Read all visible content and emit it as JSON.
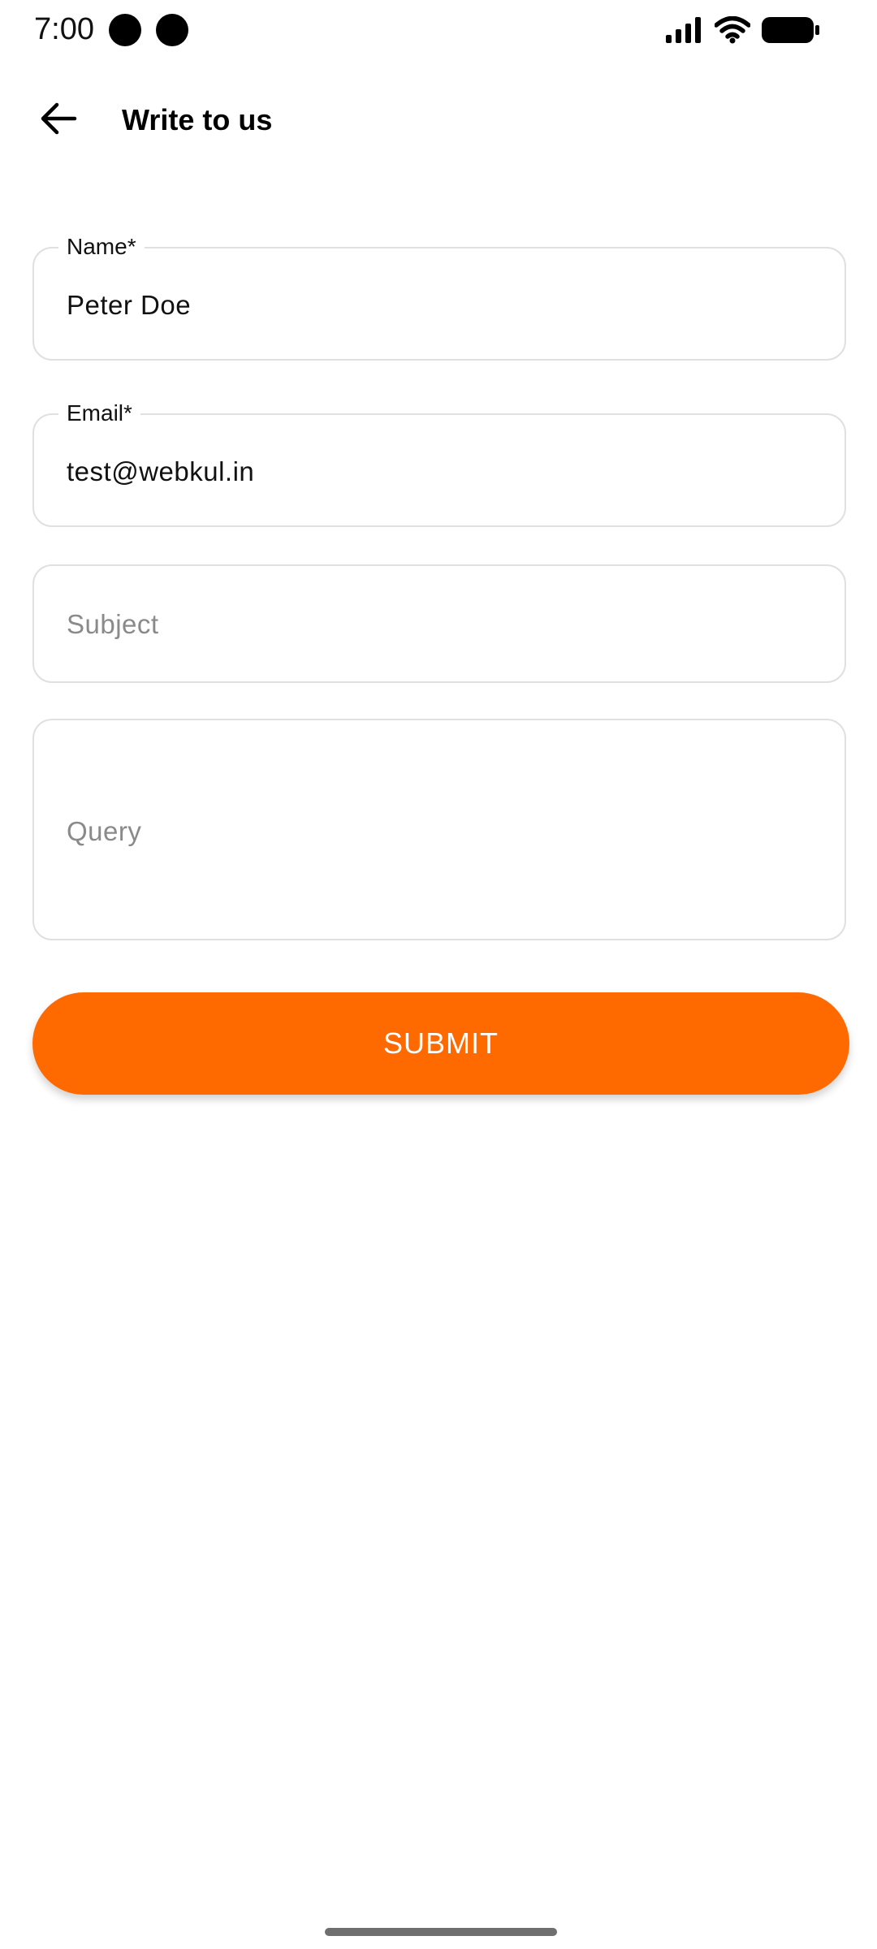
{
  "status_bar": {
    "time": "7:00",
    "icons": [
      "notification-dot-icon",
      "notification-dot-icon",
      "signal-icon",
      "wifi-icon",
      "battery-icon"
    ]
  },
  "app_bar": {
    "back_icon": "arrow-left-icon",
    "title": "Write to us"
  },
  "form": {
    "name": {
      "label": "Name*",
      "value": "Peter Doe"
    },
    "email": {
      "label": "Email*",
      "value": "test@webkul.in"
    },
    "subject": {
      "placeholder": "Subject",
      "value": ""
    },
    "query": {
      "placeholder": "Query",
      "value": ""
    },
    "submit_label": "SUBMIT"
  },
  "colors": {
    "accent": "#ff6a00",
    "field_border": "#e0e0e0",
    "placeholder": "#8a8a8a"
  }
}
